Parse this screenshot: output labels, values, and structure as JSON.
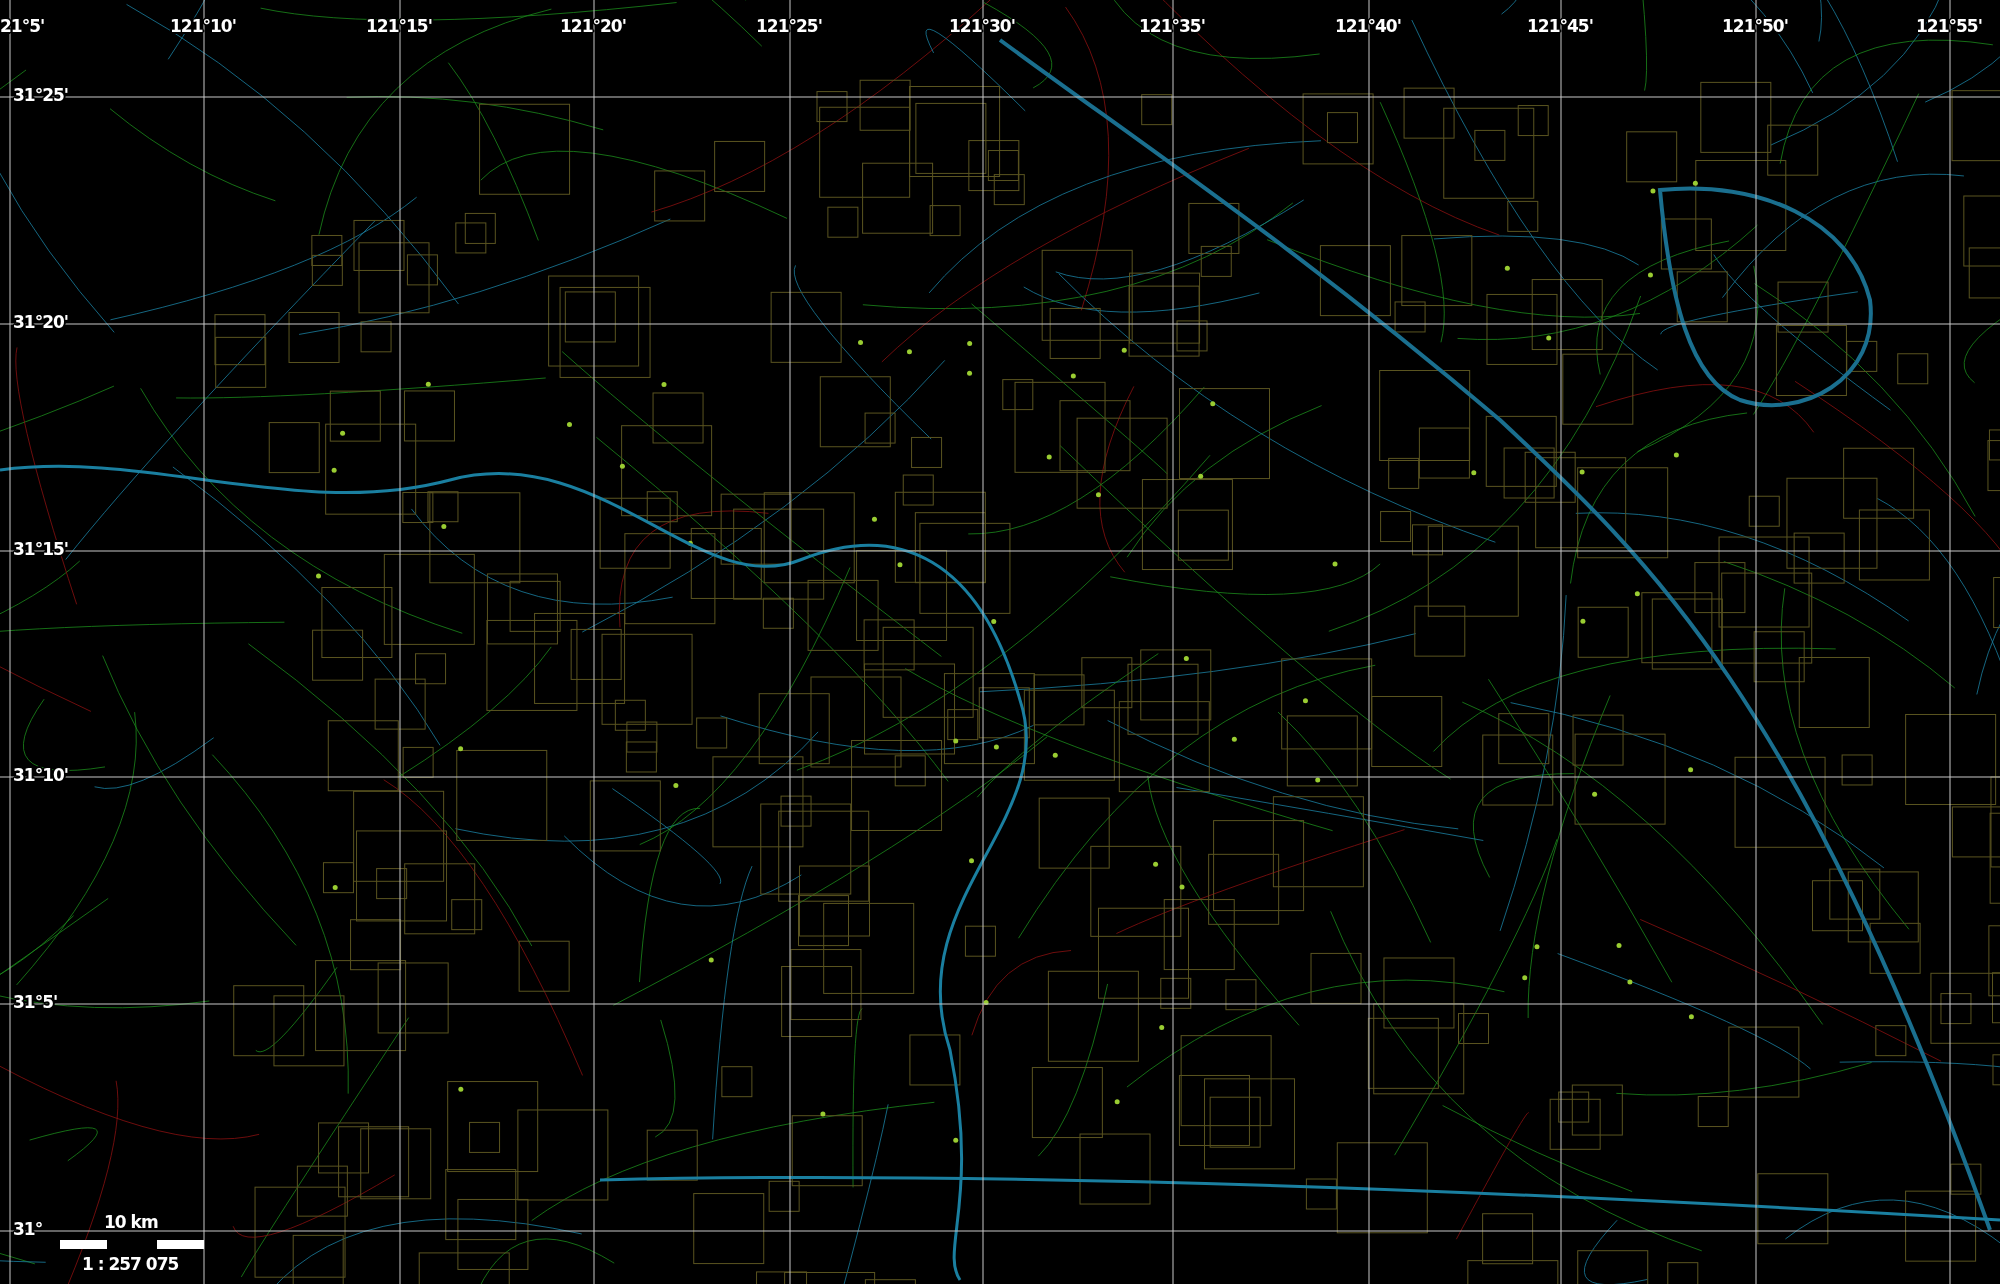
{
  "map": {
    "longitude_labels": [
      "21°5'",
      "121°10'",
      "121°15'",
      "121°20'",
      "121°25'",
      "121°30'",
      "121°35'",
      "121°40'",
      "121°45'",
      "121°50'",
      "121°55'"
    ],
    "latitude_labels": [
      "31°25'",
      "31°20'",
      "31°15'",
      "31°10'",
      "31°5'",
      "31°"
    ],
    "scale_bar": {
      "distance": "10 km",
      "ratio": "1 : 257 075"
    }
  }
}
